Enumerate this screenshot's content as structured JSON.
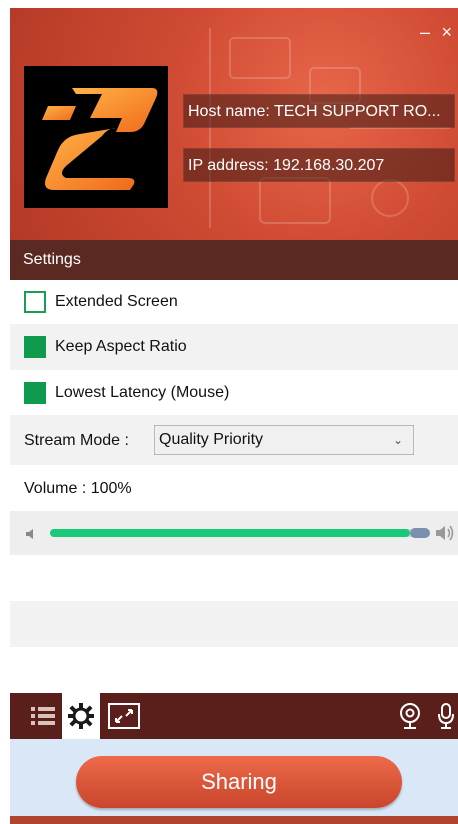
{
  "window": {
    "minimize_symbol": "–",
    "close_symbol": "×"
  },
  "header": {
    "host_text": "Host name: TECH SUPPORT RO...",
    "ip_text": "IP address: 192.168.30.207",
    "logo": "z2-logo"
  },
  "settings": {
    "title": "Settings",
    "extended_screen": {
      "label": "Extended Screen",
      "checked": false
    },
    "keep_aspect_ratio": {
      "label": "Keep Aspect Ratio",
      "checked": true
    },
    "lowest_latency": {
      "label": "Lowest Latency  (Mouse)",
      "checked": true
    },
    "stream_mode": {
      "label": "Stream Mode :",
      "value": "Quality Priority"
    },
    "volume": {
      "label": "Volume  : 100%",
      "value": 1.0
    }
  },
  "toolbar": {
    "icons_left": [
      "list-icon",
      "gear-icon",
      "fullscreen-icon"
    ],
    "icons_right": [
      "webcam-icon",
      "microphone-icon"
    ]
  },
  "share": {
    "button_label": "Sharing"
  },
  "colors": {
    "accent_green": "#109a4d",
    "slider_fill": "#18c97a",
    "header_red": "#cf4a32",
    "toolbar_dark": "#5a1f1a"
  }
}
